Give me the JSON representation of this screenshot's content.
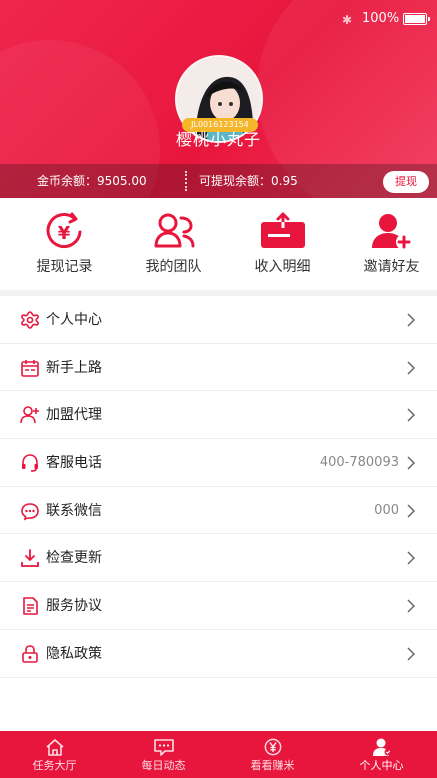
{
  "status": {
    "battery": "100%"
  },
  "profile": {
    "user_id": "JL0016123154",
    "username": "樱桃小丸子",
    "coin_balance": "金币余额：9505.00",
    "withdrawable_balance": "可提现余额：0.95",
    "withdraw_button": "提现"
  },
  "quick_actions": [
    {
      "label": "提现记录",
      "icon": "yuan-refresh-icon"
    },
    {
      "label": "我的团队",
      "icon": "team-icon"
    },
    {
      "label": "收入明细",
      "icon": "card-income-icon"
    },
    {
      "label": "邀请好友",
      "icon": "add-user-icon"
    }
  ],
  "menu": [
    {
      "label": "个人中心",
      "value": "",
      "icon": "gear-flower-icon"
    },
    {
      "label": "新手上路",
      "value": "",
      "icon": "calendar-icon"
    },
    {
      "label": "加盟代理",
      "value": "",
      "icon": "user-plus-icon"
    },
    {
      "label": "客服电话",
      "value": "400-780093",
      "icon": "headset-icon"
    },
    {
      "label": "联系微信",
      "value": "000",
      "icon": "chat-bubble-icon"
    },
    {
      "label": "检查更新",
      "value": "",
      "icon": "download-icon"
    },
    {
      "label": "服务协议",
      "value": "",
      "icon": "document-icon"
    },
    {
      "label": "隐私政策",
      "value": "",
      "icon": "lock-icon"
    }
  ],
  "tabs": [
    {
      "label": "任务大厅",
      "icon": "home-icon",
      "active": false
    },
    {
      "label": "每日动态",
      "icon": "message-icon",
      "active": false
    },
    {
      "label": "看看赚米",
      "icon": "yuan-circle-icon",
      "active": false
    },
    {
      "label": "个人中心",
      "icon": "person-icon",
      "active": true
    }
  ],
  "colors": {
    "primary": "#e8163d",
    "accent": "#f6b62a"
  }
}
